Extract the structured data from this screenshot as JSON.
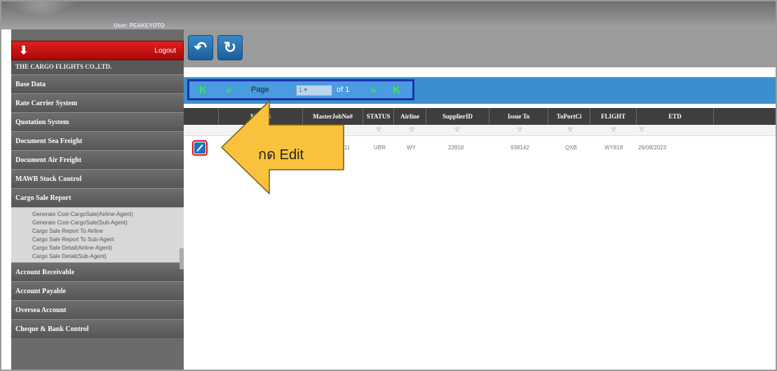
{
  "header": {
    "user_label": "User: PEAKEYOTO",
    "logo_icon": "up-arrow-logo-icon"
  },
  "sidebar": {
    "logout": {
      "icon": "down-arrow-icon",
      "label": "Logout"
    },
    "company": "THE CARGO FLIGHTS CO.,LTD.",
    "items": [
      {
        "label": "Base Data"
      },
      {
        "label": "Rate Carrier System"
      },
      {
        "label": "Quotation System"
      },
      {
        "label": "Document Sea Freight"
      },
      {
        "label": "Document Air Freight"
      },
      {
        "label": "MAWB Stock Control"
      },
      {
        "label": "Cargo Sale Report"
      }
    ],
    "subitems": [
      {
        "label": "Generate Cost-CargoSale(Airline-Agent)"
      },
      {
        "label": "Generate Cost-CargoSale(Sub-Agent)"
      },
      {
        "label": "Cargo Sale Report To Airline"
      },
      {
        "label": "Cargo Sale Report To Sub-Agent"
      },
      {
        "label": "Cargo Sale Detail(Airline-Agent)"
      },
      {
        "label": "Cargo Sale Detail(Sub-Agent)"
      }
    ],
    "items_after": [
      {
        "label": "Account Receivable"
      },
      {
        "label": "Account Payable"
      },
      {
        "label": "Oversea Account"
      },
      {
        "label": "Cheque & Bank Control"
      }
    ]
  },
  "toolbar": {
    "back_icon": "back-arrow-icon",
    "refresh_icon": "refresh-icon"
  },
  "pager": {
    "first": "K",
    "prev": "«",
    "page_label": "Page",
    "page_value": "1",
    "of_label": "of 1",
    "next": "»",
    "last": "K"
  },
  "grid": {
    "columns": [
      "MAWB",
      "MasterJobNo#",
      "STATUS",
      "Airline",
      "SupplierID",
      "Issue To",
      "ToPortCi",
      "FLIGHT",
      "ETD"
    ],
    "row": {
      "masterjob": "0611",
      "status": "UBR",
      "airline": "WY",
      "supplier": "23918",
      "issue_to": "938142",
      "toport": "QXB",
      "flight": "WY818",
      "etd": "26/08/2023"
    }
  },
  "callout": {
    "text": "กด Edit",
    "fill": "#f9c23c",
    "stroke": "#7a5a10"
  }
}
